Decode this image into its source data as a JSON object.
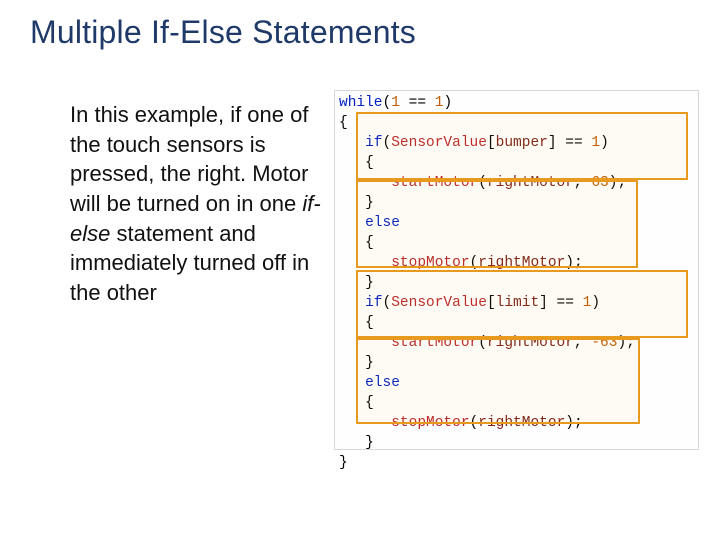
{
  "title": "Multiple If-Else Statements",
  "paragraph": {
    "p1": "In this example, if one of the touch sensors is pressed, the right. Motor will be turned on in one ",
    "em": "if-else",
    "p2": " statement and immediately turned off in the other"
  },
  "code": {
    "l01_a": "while",
    "l01_b": "(",
    "l01_c": "1",
    "l01_d": " == ",
    "l01_e": "1",
    "l01_f": ")",
    "l02": "{",
    "l03_a": "   if",
    "l03_b": "(",
    "l03_c": "SensorValue",
    "l03_d": "[",
    "l03_e": "bumper",
    "l03_f": "] == ",
    "l03_g": "1",
    "l03_h": ")",
    "l04": "   {",
    "l05_a": "      ",
    "l05_b": "startMotor",
    "l05_c": "(",
    "l05_d": "rightMotor",
    "l05_e": ", ",
    "l05_f": "63",
    "l05_g": ");",
    "l06": "   }",
    "l07_a": "   else",
    "l08": "   {",
    "l09_a": "      ",
    "l09_b": "stopMotor",
    "l09_c": "(",
    "l09_d": "rightMotor",
    "l09_e": ");",
    "l10": "   }",
    "l11_a": "   if",
    "l11_b": "(",
    "l11_c": "SensorValue",
    "l11_d": "[",
    "l11_e": "limit",
    "l11_f": "] == ",
    "l11_g": "1",
    "l11_h": ")",
    "l12": "   {",
    "l13_a": "      ",
    "l13_b": "startMotor",
    "l13_c": "(",
    "l13_d": "rightMotor",
    "l13_e": ", ",
    "l13_f": "-63",
    "l13_g": ");",
    "l14": "   }",
    "l15_a": "   else",
    "l16": "   {",
    "l17_a": "      ",
    "l17_b": "stopMotor",
    "l17_c": "(",
    "l17_d": "rightMotor",
    "l17_e": ");",
    "l18": "   }",
    "l19": "}"
  }
}
